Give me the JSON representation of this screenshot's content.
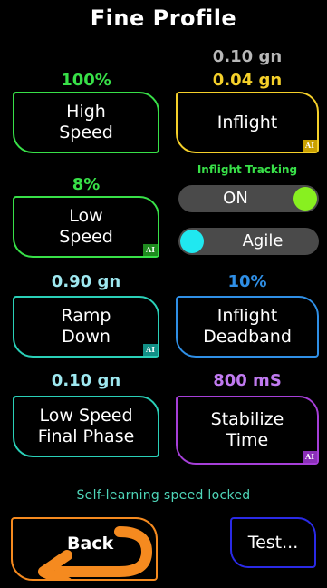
{
  "title": "Fine Profile",
  "colors": {
    "green": "#38e048",
    "yellow": "#f5d02a",
    "teal_light": "#9ee8f0",
    "teal": "#2ad0b8",
    "blue": "#2f8fe6",
    "purple": "#c07af0",
    "gray_value": "#b8b8b8",
    "toggle_green": "#88f020",
    "toggle_cyan": "#20e8f0"
  },
  "ai_badge": "AI",
  "left": {
    "high_speed": {
      "value": "100%",
      "label": "High\nSpeed"
    },
    "low_speed": {
      "value": "8%",
      "label": "Low\nSpeed"
    },
    "ramp_down": {
      "value": "0.90 gn",
      "label": "Ramp\nDown"
    },
    "low_speed_final": {
      "value": "0.10 gn",
      "label": "Low Speed\nFinal Phase"
    }
  },
  "right": {
    "inflight": {
      "value_top": "0.10 gn",
      "value": "0.04 gn",
      "label": "Inflight"
    },
    "tracking": {
      "caption": "Inflight Tracking",
      "toggle1": "ON",
      "toggle2": "Agile"
    },
    "inflight_deadband": {
      "value": "10%",
      "label": "Inflight\nDeadband"
    },
    "stabilize_time": {
      "value": "800 mS",
      "label": "Stabilize\nTime"
    }
  },
  "status_text": "Self-learning speed locked",
  "back_label": "Back",
  "test_label": "Test...",
  "icons": {
    "back_arrow": "back-arrow-icon"
  }
}
